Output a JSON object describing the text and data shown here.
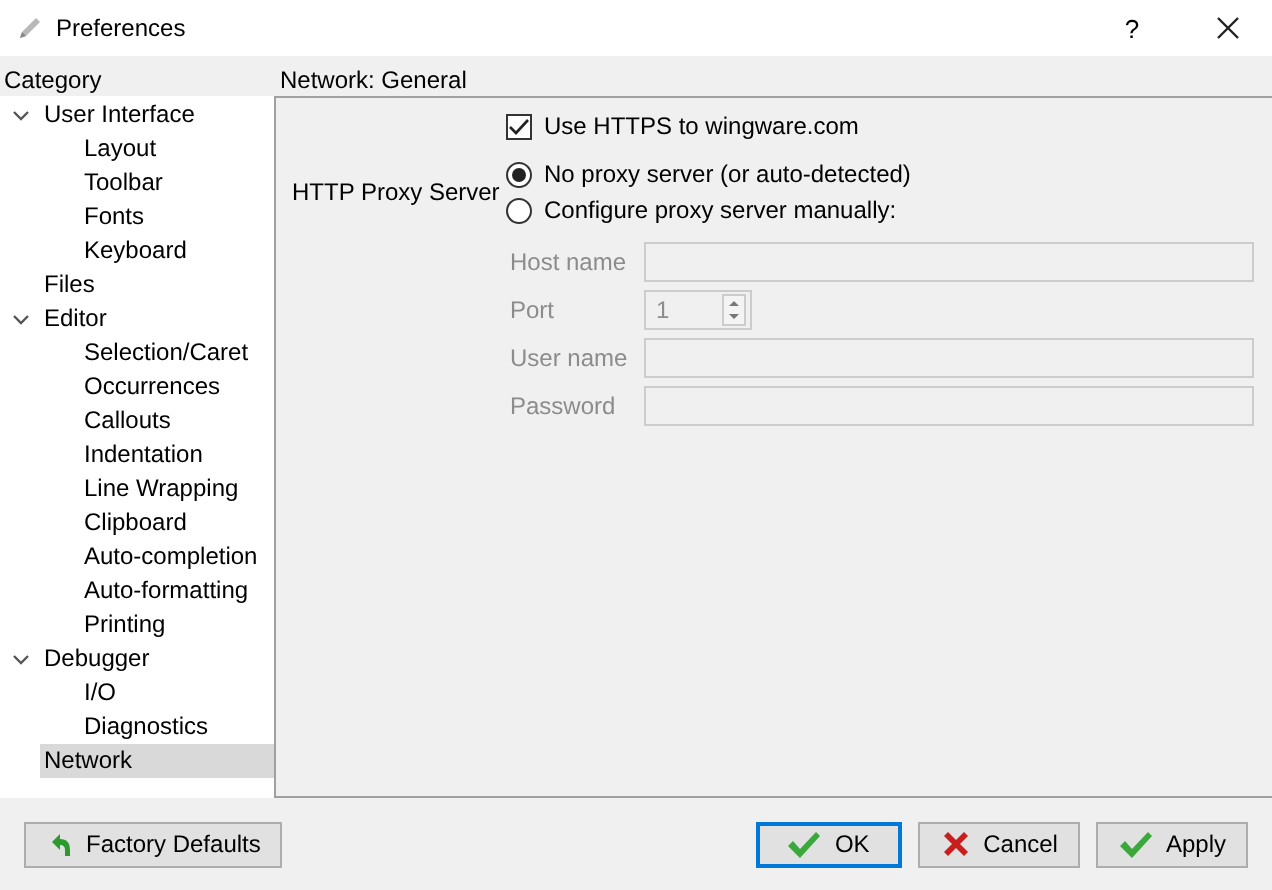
{
  "window": {
    "title": "Preferences",
    "help": "?"
  },
  "sidebar": {
    "header": "Category",
    "items": [
      {
        "label": "User Interface",
        "expanded": true,
        "selected": false,
        "children": [
          {
            "label": "Layout",
            "selected": false
          },
          {
            "label": "Toolbar",
            "selected": false
          },
          {
            "label": "Fonts",
            "selected": false
          },
          {
            "label": "Keyboard",
            "selected": false
          }
        ]
      },
      {
        "label": "Files",
        "selected": false
      },
      {
        "label": "Editor",
        "expanded": true,
        "selected": false,
        "children": [
          {
            "label": "Selection/Caret",
            "selected": false
          },
          {
            "label": "Occurrences",
            "selected": false
          },
          {
            "label": "Callouts",
            "selected": false
          },
          {
            "label": "Indentation",
            "selected": false
          },
          {
            "label": "Line Wrapping",
            "selected": false
          },
          {
            "label": "Clipboard",
            "selected": false
          },
          {
            "label": "Auto-completion",
            "selected": false
          },
          {
            "label": "Auto-formatting",
            "selected": false
          },
          {
            "label": "Printing",
            "selected": false
          }
        ]
      },
      {
        "label": "Debugger",
        "expanded": true,
        "selected": false,
        "children": [
          {
            "label": "I/O",
            "selected": false
          },
          {
            "label": "Diagnostics",
            "selected": false
          }
        ]
      },
      {
        "label": "Network",
        "selected": true
      }
    ]
  },
  "panel": {
    "title": "Network: General",
    "https": {
      "label": "Use HTTPS to wingware.com",
      "checked": true
    },
    "proxy_label": "HTTP Proxy Server",
    "proxy_options": [
      {
        "label": "No proxy server (or auto-detected)",
        "selected": true
      },
      {
        "label": "Configure proxy server manually:",
        "selected": false
      }
    ],
    "fields": [
      {
        "kind": "text",
        "label": "Host name",
        "disabled": true
      },
      {
        "kind": "spin",
        "label": "Port",
        "value": "1",
        "disabled": true
      },
      {
        "kind": "text",
        "label": "User name",
        "disabled": true
      },
      {
        "kind": "text",
        "label": "Password",
        "disabled": true
      }
    ]
  },
  "buttons": [
    {
      "kind": "undo",
      "label": "Factory Defaults",
      "focused": false
    },
    {
      "kind": "ok",
      "label": "OK",
      "focused": true
    },
    {
      "kind": "cancel",
      "label": "Cancel",
      "focused": false
    },
    {
      "kind": "ok",
      "label": "Apply",
      "focused": false
    }
  ]
}
